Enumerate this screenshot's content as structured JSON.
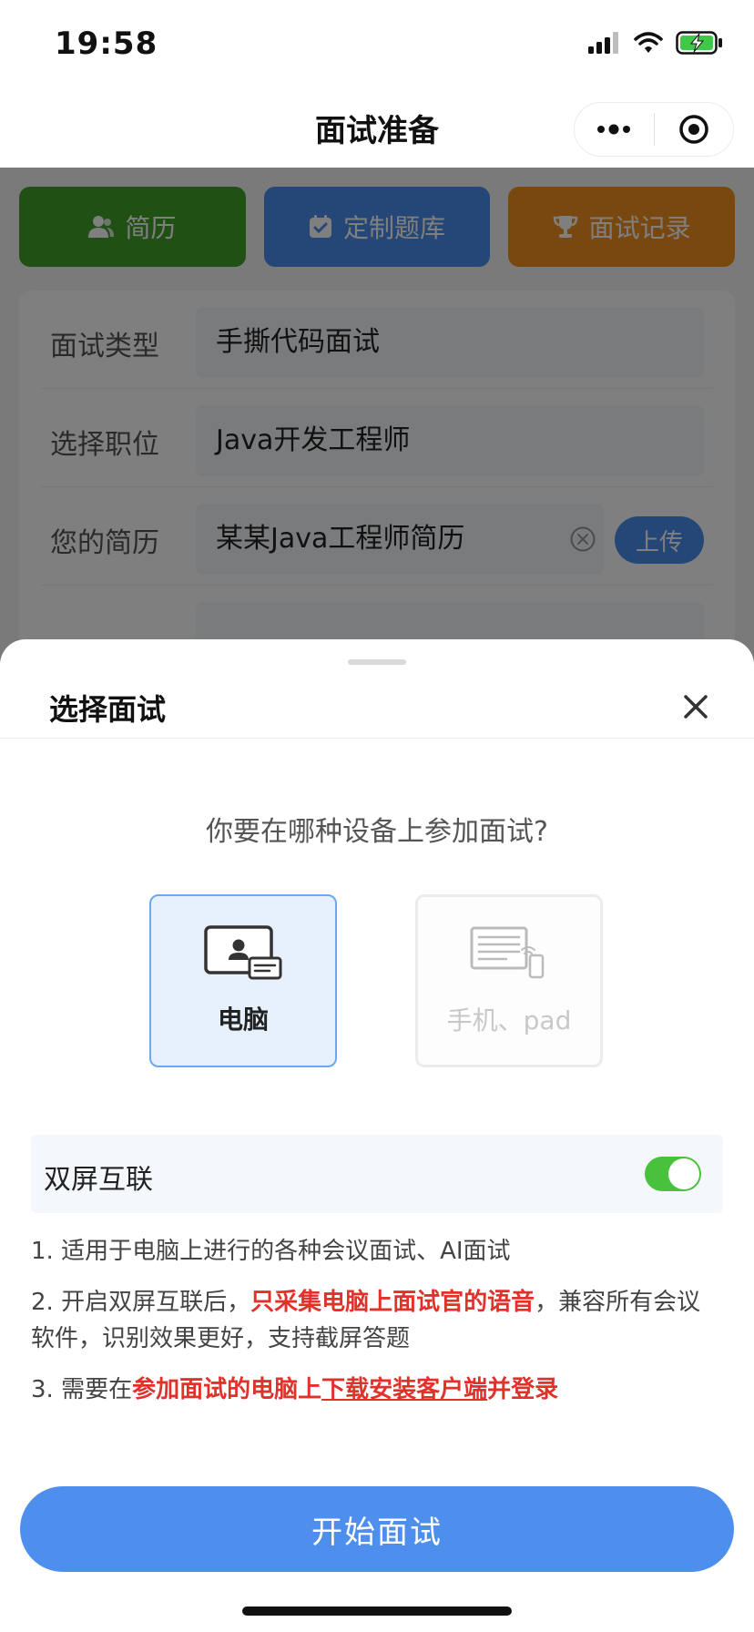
{
  "status_bar": {
    "time": "19:58"
  },
  "nav": {
    "title": "面试准备"
  },
  "quick_actions": [
    {
      "label": "简历",
      "color": "#43a12b"
    },
    {
      "label": "定制题库",
      "color": "#4b8ff0"
    },
    {
      "label": "面试记录",
      "color": "#f39021"
    }
  ],
  "form": {
    "type_label": "面试类型",
    "type_value": "手撕代码面试",
    "position_label": "选择职位",
    "position_value": "Java开发工程师",
    "resume_label": "您的简历",
    "resume_value": "某某Java工程师简历",
    "upload_label": "上传"
  },
  "sheet": {
    "title": "选择面试",
    "question": "你要在哪种设备上参加面试?",
    "devices": [
      {
        "label": "电脑",
        "selected": true
      },
      {
        "label": "手机、pad",
        "selected": false
      }
    ],
    "dual_screen": {
      "label": "双屏互联",
      "enabled": true
    },
    "notes": {
      "n1": "1. 适用于电脑上进行的各种会议面试、AI面试",
      "n2_a": "2. 开启双屏互联后，",
      "n2_b": "只采集电脑上面试官的语音",
      "n2_c": "，兼容所有会议软件，识别效果更好，支持截屏答题",
      "n3_a": "3. 需要在",
      "n3_b": "参加面试的电脑上",
      "n3_c": "下载安装客户端",
      "n3_d": "并登录"
    },
    "start_label": "开始面试"
  },
  "colors": {
    "accent": "#4e8fee",
    "highlight": "#e0322a",
    "toggle_on": "#48c23c"
  }
}
